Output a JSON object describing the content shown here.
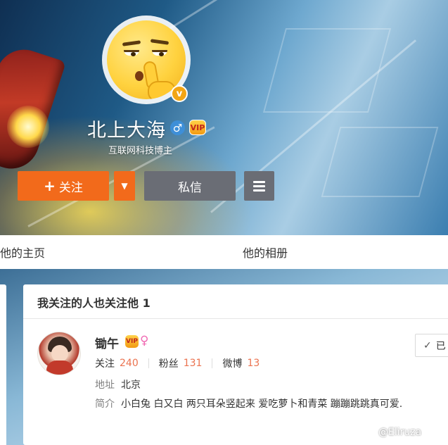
{
  "profile": {
    "username": "北上大海",
    "subtitle": "互联网科技博主",
    "verified_glyph": "v",
    "gender_glyph": "♂",
    "vip_glyph": "VIP"
  },
  "actions": {
    "follow_plus": "+",
    "follow_label": "关注",
    "dropdown_glyph": "▼",
    "message_label": "私信"
  },
  "tabs": [
    {
      "label": "他的主页"
    },
    {
      "label": "他的相册"
    }
  ],
  "mutual": {
    "title": "我关注的人也关注他 1",
    "user": {
      "name": "锄午",
      "vip_glyph": "VIP",
      "gender_glyph": "♀",
      "stats": [
        {
          "label": "关注",
          "value": "240"
        },
        {
          "label": "粉丝",
          "value": "131"
        },
        {
          "label": "微博",
          "value": "13"
        }
      ],
      "address_label": "地址",
      "address": "北京",
      "intro_label": "简介",
      "intro": "小白兔 白又白 两只耳朵竖起来 爱吃萝卜和青菜 蹦蹦跳跳真可爱.",
      "follow_state_check": "✓",
      "follow_state_label": "已"
    }
  },
  "watermark": "@Eliruza",
  "colors": {
    "accent_orange": "#f26a1b",
    "button_gray": "#6a6d75",
    "stat_number": "#eb7350"
  },
  "icons": [
    "verified-badge-icon",
    "male-icon",
    "vip-icon",
    "plus-icon",
    "chevron-down-icon",
    "menu-icon",
    "female-icon",
    "check-icon"
  ]
}
